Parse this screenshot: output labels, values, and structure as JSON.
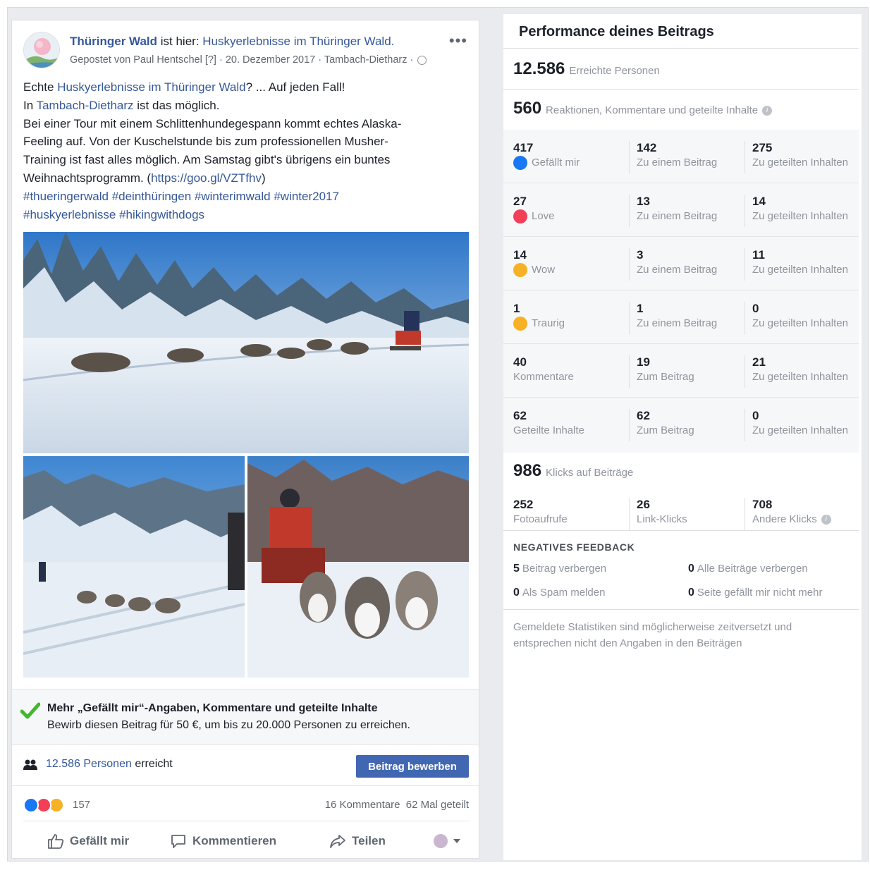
{
  "post": {
    "page_name": "Thüringer Wald",
    "is_at": " ist hier: ",
    "location": "Huskyerlebnisse im Thüringer Wald.",
    "meta": "Gepostet von Paul Hentschel [?] · 20. Dezember 2017 · Tambach-Dietharz ·",
    "more": "•••",
    "text": {
      "l1_a": "Echte ",
      "l1_link": "Huskyerlebnisse im Thüringer Wald",
      "l1_b": "? ... Auf jeden Fall!",
      "l2_a": "In ",
      "l2_link": "Tambach-Dietharz",
      "l2_b": " ist das möglich.",
      "l3": "Bei einer Tour mit einem Schlittenhundegespann kommt echtes Alaska-",
      "l4": "Feeling auf. Von der Kuschelstunde bis zum professionellen Musher-",
      "l5": "Training ist fast alles möglich. Am Samstag gibt's übrigens ein buntes",
      "l6_a": "Weihnachtsprogramm. (",
      "l6_link": "https://goo.gl/VZTfhv",
      "l6_b": ")",
      "l7": "#thueringerwald #deinthüringen #winterimwald #winter2017",
      "l8": "#huskyerlebnisse #hikingwithdogs"
    },
    "boost": {
      "title": "Mehr „Gefällt mir“-Angaben, Kommentare und geteilte Inhalte",
      "subtitle": "Bewirb diesen Beitrag für 50 €, um bis zu 20.000 Personen zu erreichen."
    },
    "reach": {
      "people_link": "12.586 Personen",
      "suffix": " erreicht",
      "button": "Beitrag bewerben"
    },
    "stats": {
      "reaction_count": "157",
      "comments": "16 Kommentare",
      "shares": "62 Mal geteilt"
    },
    "actions": {
      "like": "Gefällt mir",
      "comment": "Kommentieren",
      "share": "Teilen"
    }
  },
  "performance": {
    "title": "Performance deines Beitrags",
    "reach_num": "12.586",
    "reach_lbl": "Erreichte Personen",
    "engage_num": "560",
    "engage_lbl": "Reaktionen, Kommentare und geteilte Inhalte",
    "rows": [
      {
        "n1": "417",
        "l1": "Gefällt mir",
        "n2": "142",
        "l2": "Zu einem Beitrag",
        "n3": "275",
        "l3": "Zu geteilten Inhalten"
      },
      {
        "n1": "27",
        "l1": "Love",
        "n2": "13",
        "l2": "Zu einem Beitrag",
        "n3": "14",
        "l3": "Zu geteilten Inhalten"
      },
      {
        "n1": "14",
        "l1": "Wow",
        "n2": "3",
        "l2": "Zu einem Beitrag",
        "n3": "11",
        "l3": "Zu geteilten Inhalten"
      },
      {
        "n1": "1",
        "l1": "Traurig",
        "n2": "1",
        "l2": "Zu einem Beitrag",
        "n3": "0",
        "l3": "Zu geteilten Inhalten"
      },
      {
        "n1": "40",
        "l1": "Kommentare",
        "n2": "19",
        "l2": "Zum Beitrag",
        "n3": "21",
        "l3": "Zu geteilten Inhalten"
      },
      {
        "n1": "62",
        "l1": "Geteilte Inhalte",
        "n2": "62",
        "l2": "Zum Beitrag",
        "n3": "0",
        "l3": "Zu geteilten Inhalten"
      }
    ],
    "clicks_num": "986",
    "clicks_lbl": "Klicks auf Beiträge",
    "clicks": {
      "n1": "252",
      "l1": "Fotoaufrufe",
      "n2": "26",
      "l2": "Link-Klicks",
      "n3": "708",
      "l3": "Andere Klicks"
    },
    "negative_title": "NEGATIVES FEEDBACK",
    "negative": [
      {
        "num": "5",
        "label": "Beitrag verbergen"
      },
      {
        "num": "0",
        "label": "Alle Beiträge verbergen"
      },
      {
        "num": "0",
        "label": "Als Spam melden"
      },
      {
        "num": "0",
        "label": "Seite gefällt mir nicht mehr"
      }
    ],
    "note": "Gemeldete Statistiken sind möglicherweise zeitversetzt und entsprechen nicht den Angaben in den Beiträgen"
  },
  "colors": {
    "link": "#365899",
    "button": "#4267b2",
    "like": "#1877f2",
    "love": "#f33e58",
    "wow": "#f7b125"
  }
}
